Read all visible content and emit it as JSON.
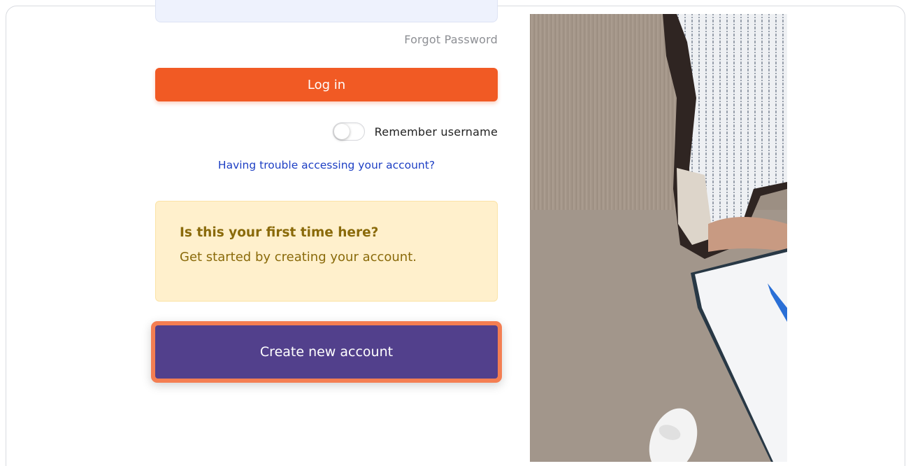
{
  "login": {
    "forgot_password": "Forgot Password",
    "login_button": "Log in",
    "remember_label": "Remember username",
    "remember_checked": false,
    "trouble_link": "Having trouble accessing your account?"
  },
  "signup_panel": {
    "heading": "Is this your first time here?",
    "text": "Get started by creating your account.",
    "create_button": "Create new account"
  },
  "colors": {
    "login_button": "#f15a24",
    "create_button": "#52408c",
    "highlight_outline": "#f47e52",
    "panel_bg": "#fff0cc",
    "panel_text": "#8a6a0a",
    "link": "#1d3fc4"
  },
  "side_image": {
    "description_icon": "photo-person-at-desk"
  }
}
